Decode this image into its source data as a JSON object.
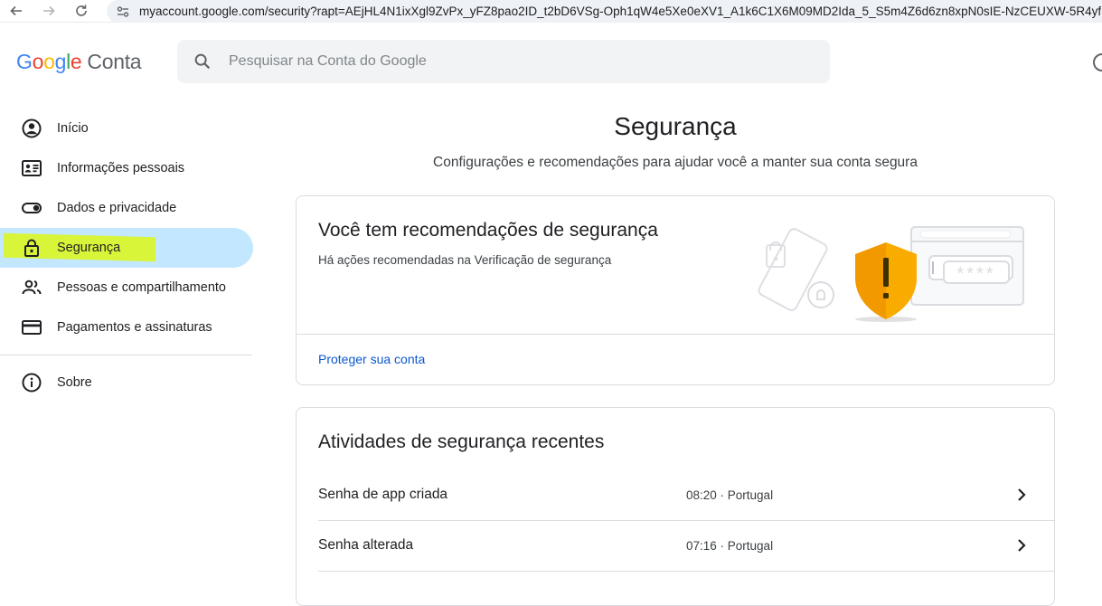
{
  "browser": {
    "url": "myaccount.google.com/security?rapt=AEjHL4N1ixXgl9ZvPx_yFZ8pao2ID_t2bD6VSg-Oph1qW4e5Xe0eXV1_A1k6C1X6M09MD2Ida_5_S5m4Z6d6zn8xpN0sIE-NzCEUXW-5R4yf"
  },
  "header": {
    "logo_letters": [
      "G",
      "o",
      "o",
      "g",
      "l",
      "e"
    ],
    "product": "Conta",
    "search_placeholder": "Pesquisar na Conta do Google"
  },
  "sidebar": {
    "items": [
      {
        "label": "Início",
        "icon": "account-circle-icon"
      },
      {
        "label": "Informações pessoais",
        "icon": "id-card-icon"
      },
      {
        "label": "Dados e privacidade",
        "icon": "toggle-icon"
      },
      {
        "label": "Segurança",
        "icon": "lock-icon",
        "active": true
      },
      {
        "label": "Pessoas e compartilhamento",
        "icon": "people-icon"
      },
      {
        "label": "Pagamentos e assinaturas",
        "icon": "credit-card-icon"
      }
    ],
    "about": {
      "label": "Sobre",
      "icon": "info-icon"
    }
  },
  "main": {
    "title": "Segurança",
    "subtitle": "Configurações e recomendações para ajudar você a manter sua conta segura",
    "recommendations": {
      "title": "Você tem recomendações de segurança",
      "description": "Há ações recomendadas na Verificação de segurança",
      "link": "Proteger sua conta",
      "illustration_text": "****"
    },
    "activity": {
      "title": "Atividades de segurança recentes",
      "rows": [
        {
          "label": "Senha de app criada",
          "time": "08:20 · Portugal"
        },
        {
          "label": "Senha alterada",
          "time": "07:16 · Portugal"
        }
      ]
    }
  },
  "colors": {
    "accent_blue": "#0b57d0",
    "active_nav_bg": "#c2e7ff",
    "highlighter": "#d8f53a",
    "shield_orange": "#f29900"
  }
}
